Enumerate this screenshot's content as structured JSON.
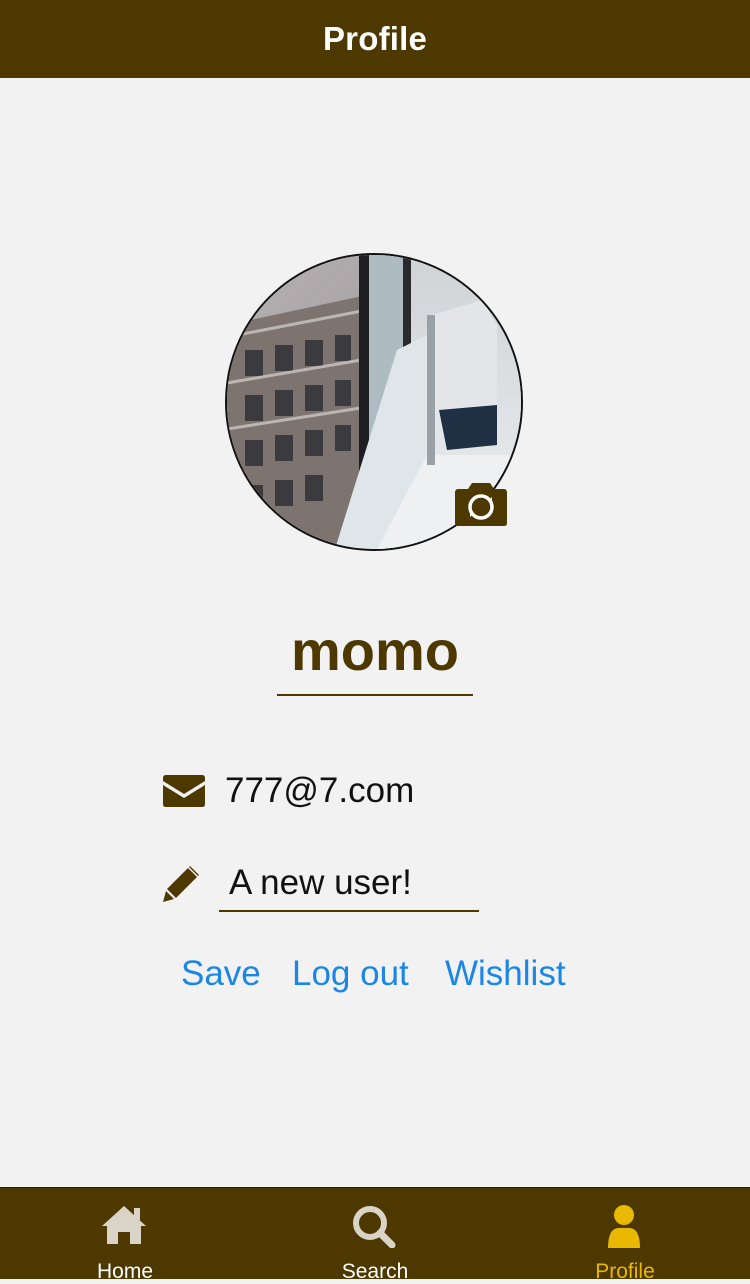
{
  "header": {
    "title": "Profile"
  },
  "profile": {
    "username": "momo",
    "email": "777@7.com",
    "bio": "A new user!"
  },
  "actions": {
    "save_label": "Save",
    "logout_label": "Log out",
    "wishlist_label": "Wishlist"
  },
  "tabs": [
    {
      "label": "Home",
      "icon": "home-icon"
    },
    {
      "label": "Search",
      "icon": "search-icon"
    },
    {
      "label": "Profile",
      "icon": "user-icon",
      "active": true
    }
  ],
  "colors": {
    "header_bg": "#4d3800",
    "accent": "#4d3800",
    "link": "#1a86e6",
    "active_tab": "#e9b800",
    "inactive_tab_icon": "#d9d4c7"
  }
}
